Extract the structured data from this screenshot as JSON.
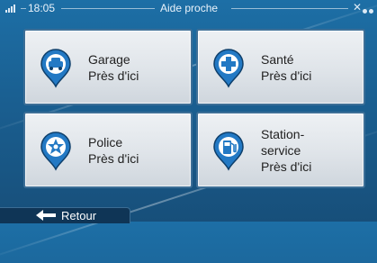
{
  "status_bar": {
    "time": "18:05",
    "title": "Aide proche",
    "icons": [
      "signal-icon",
      "gps-icon",
      "menu-dots-icon"
    ]
  },
  "tiles": [
    {
      "id": "garage",
      "icon": "car-pin-icon",
      "label": "Garage\nPrès d'ici"
    },
    {
      "id": "sante",
      "icon": "medical-cross-pin-icon",
      "label": "Santé\nPrès d'ici"
    },
    {
      "id": "police",
      "icon": "police-badge-pin-icon",
      "label": "Police\nPrès d'ici"
    },
    {
      "id": "station",
      "icon": "fuel-pump-pin-icon",
      "label": "Station-\nservice\nPrès d'ici"
    }
  ],
  "footer": {
    "back_label": "Retour",
    "back_icon": "arrow-left-icon"
  },
  "colors": {
    "background": "#1a5f91",
    "tile_border": "#3d6f97",
    "pin_blue": "#2379c4",
    "footer": "#0f3556"
  }
}
